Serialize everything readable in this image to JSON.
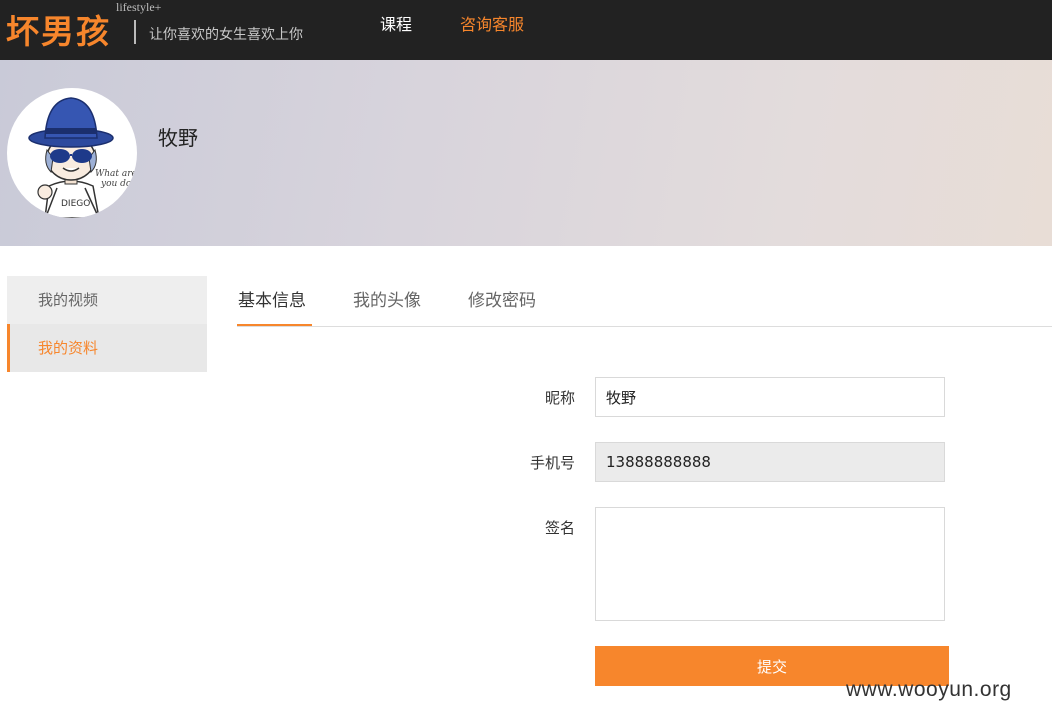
{
  "header": {
    "logo": "坏男孩",
    "logo_sup": "lifestyle+",
    "slogan": "让你喜欢的女生喜欢上你",
    "nav": [
      {
        "label": "课程"
      },
      {
        "label": "咨询客服"
      }
    ]
  },
  "profile": {
    "username": "牧野",
    "avatar_icon": "cartoon-avatar"
  },
  "sidebar": {
    "items": [
      {
        "label": "我的视频"
      },
      {
        "label": "我的资料"
      }
    ]
  },
  "tabs": [
    {
      "label": "基本信息"
    },
    {
      "label": "我的头像"
    },
    {
      "label": "修改密码"
    }
  ],
  "form": {
    "nickname_label": "昵称",
    "nickname_value": "牧野",
    "phone_label": "手机号",
    "phone_value": "13888888888",
    "signature_label": "签名",
    "signature_value": "",
    "submit_label": "提交"
  },
  "watermark": "www.wooyun.org",
  "colors": {
    "accent": "#f7862c",
    "topbar": "#222222"
  }
}
